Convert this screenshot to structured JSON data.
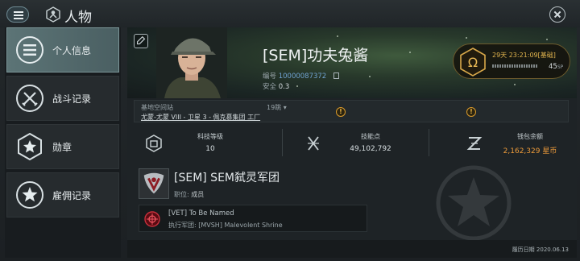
{
  "window": {
    "title": "人物"
  },
  "sidebar": {
    "items": [
      {
        "label": "个人信息",
        "icon": "menu-lines-icon",
        "active": true
      },
      {
        "label": "战斗记录",
        "icon": "crossed-swords-icon",
        "active": false
      },
      {
        "label": "勋章",
        "icon": "star-hexagon-icon",
        "active": false
      },
      {
        "label": "雇佣记录",
        "icon": "star-circle-icon",
        "active": false
      }
    ]
  },
  "character": {
    "name": "[SEM]功夫兔酱",
    "id_label": "编号",
    "id_value": "10000087372",
    "sec_label": "安全",
    "sec_value": "0.3"
  },
  "omega": {
    "time": "29天 23:21:09[基础]",
    "sp_value": "45",
    "sp_unit": "SP",
    "accent": "#e2b54e"
  },
  "location": {
    "label": "基地空间站",
    "jumps": "19跳",
    "value": "尤蒙-尤蒙 VIII - 卫星 3 - 佩克慕集团 工厂"
  },
  "stats": [
    {
      "label": "科技等级",
      "value": "10",
      "icon": "tech-level-icon"
    },
    {
      "label": "技能点",
      "value": "49,102,792",
      "icon": "skillpoints-icon"
    },
    {
      "label": "钱包余额",
      "value": "2,162,329 星币",
      "icon": "isk-icon"
    }
  ],
  "corporation": {
    "name": "[SEM] SEM弑灵军团",
    "role_label": "职位:",
    "role_value": "成员"
  },
  "alliance": {
    "name": "[VET] To Be Named",
    "faction": "执行军团: [MVSH] Malevolent Shrine"
  },
  "footer": {
    "date": "履历日期 2020.06.13"
  }
}
